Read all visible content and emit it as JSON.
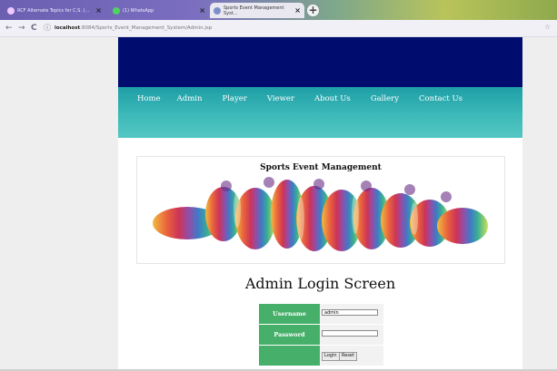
{
  "browser": {
    "tabs": [
      {
        "label": "RCF Alternate Topics for C.S. (...",
        "fav_color": "#f1c8ff",
        "active": false
      },
      {
        "label": "(1) WhatsApp",
        "fav_color": "#4fd35e",
        "active": false
      },
      {
        "label": "Sports Event Management Syst...",
        "fav_color": "#7c8fc9",
        "active": true
      }
    ],
    "new_tab": "+",
    "nav": {
      "back": "←",
      "forward": "→",
      "reload": "C",
      "info": "ⓘ"
    },
    "url_host": "localhost",
    "url_rest": ":8084/Sports_Event_Management_System/Admin.jsp",
    "bookmark": "☆"
  },
  "site": {
    "menu": [
      "Home",
      "Admin",
      "Player",
      "Viewer",
      "About Us",
      "Gallery",
      "Contact Us"
    ],
    "banner_title": "Sports Event Management"
  },
  "login": {
    "title": "Admin Login Screen",
    "username_label": "Username",
    "username_value": "admin",
    "password_label": "Password",
    "password_value": "",
    "login_button": "Login",
    "reset_button": "Reset"
  }
}
